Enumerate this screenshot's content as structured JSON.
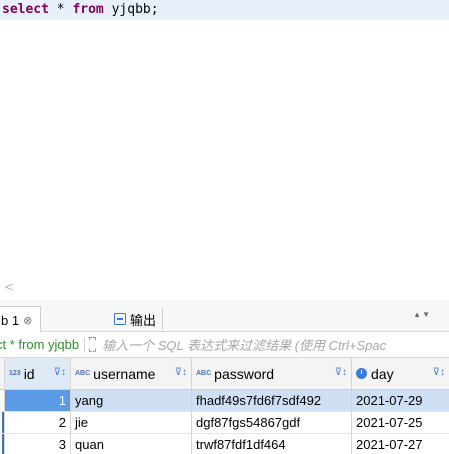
{
  "editor": {
    "sql": {
      "kw1": "select",
      "mid": " * ",
      "kw2": "from",
      "tail": " yjqbb;"
    }
  },
  "scroll": {
    "left_arrow": "<"
  },
  "tabs": [
    {
      "label": "b 1",
      "close": "⊗"
    },
    {
      "label": "输出"
    }
  ],
  "tabbar": {
    "updown": "▲▼"
  },
  "filter": {
    "query": "ct * from yjqbb",
    "placeholder": "输入一个 SQL 表达式来过滤结果 (使用 Ctrl+Spac"
  },
  "grid": {
    "columns": [
      {
        "badge": "123",
        "label": "id"
      },
      {
        "badge": "ABC",
        "label": "username"
      },
      {
        "badge": "ABC",
        "label": "password"
      },
      {
        "badge": "",
        "label": "day"
      }
    ],
    "rows": [
      {
        "id": "1",
        "username": "yang",
        "password": "fhadf49s7fd6f7sdf492",
        "day": "2021-07-29"
      },
      {
        "id": "2",
        "username": "jie",
        "password": "dgf87fgs54867gdf",
        "day": "2021-07-25"
      },
      {
        "id": "3",
        "username": "quan",
        "password": "trwf87fdf1df464",
        "day": "2021-07-27"
      }
    ]
  },
  "colors": {
    "keyword": "#7f0055",
    "query": "#2e8b2e",
    "selection": "#5b9be6"
  }
}
